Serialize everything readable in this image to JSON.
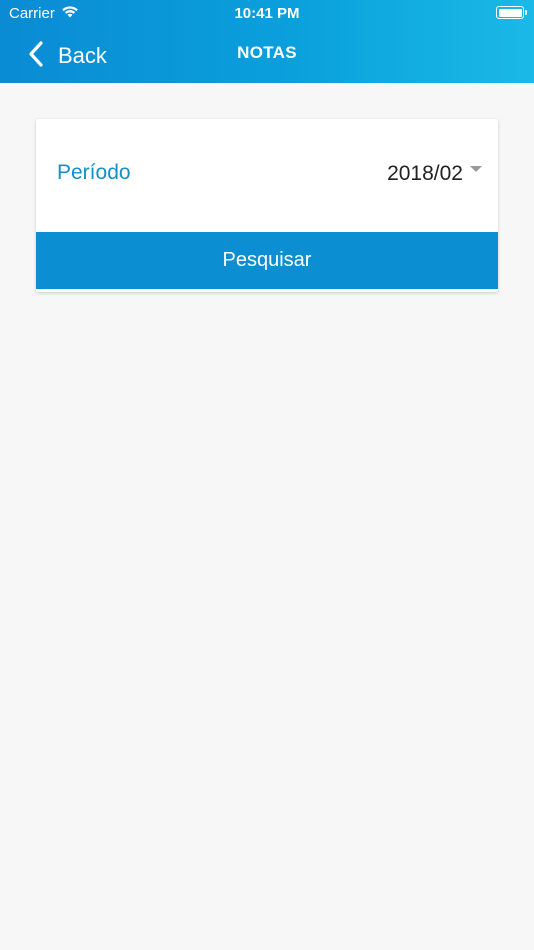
{
  "status_bar": {
    "carrier": "Carrier",
    "time": "10:41 PM"
  },
  "navbar": {
    "back_label": "Back",
    "title": "NOTAS"
  },
  "filter": {
    "periodo_label": "Período",
    "periodo_value": "2018/02",
    "search_label": "Pesquisar"
  },
  "colors": {
    "header_start": "#0a8bd4",
    "header_end": "#1ab9e6",
    "accent_text": "#1490c7",
    "button_bg": "#0b8fd2",
    "background": "#f7f7f7"
  },
  "icons": {
    "wifi": "wifi-icon",
    "battery": "battery-icon",
    "back": "chevron-left-icon",
    "dropdown": "caret-down-icon"
  }
}
